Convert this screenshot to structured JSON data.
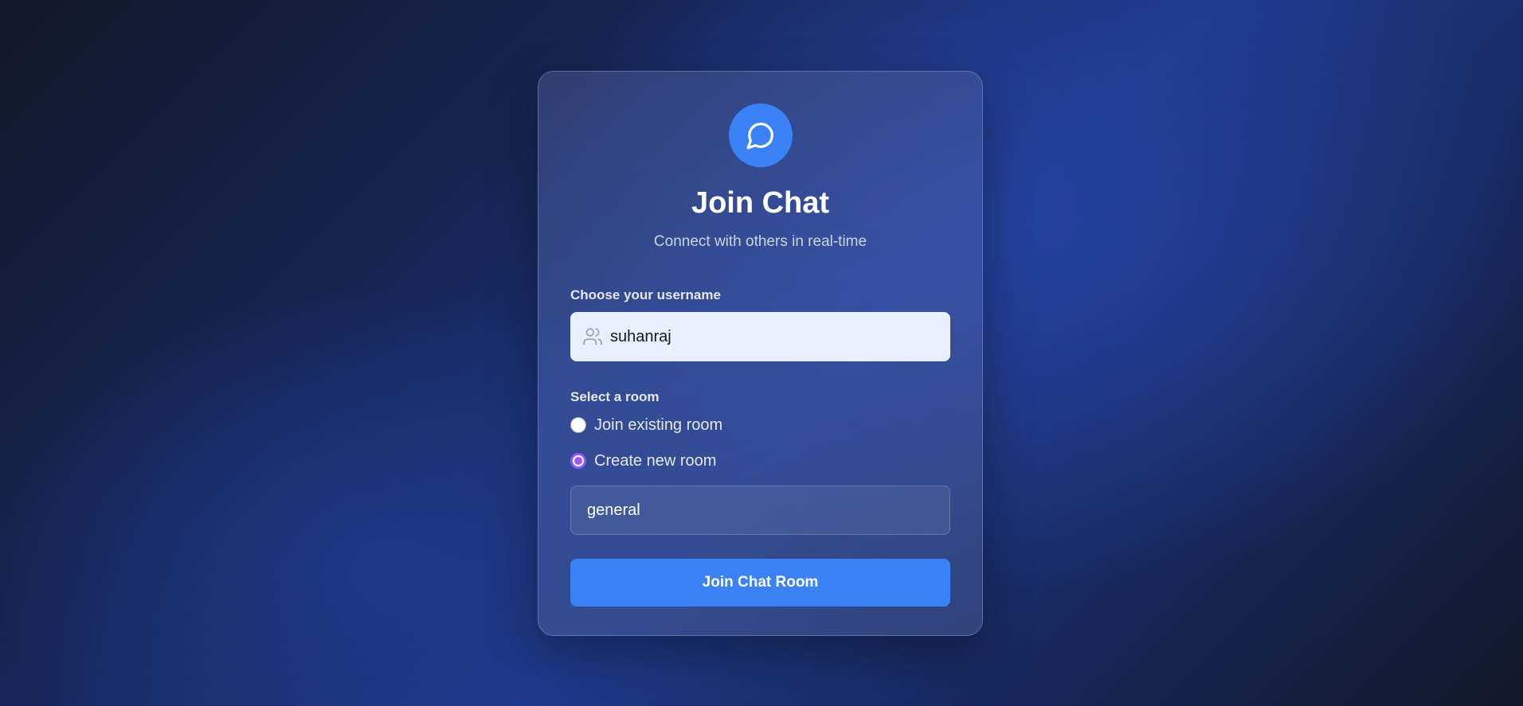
{
  "colors": {
    "accent": "#3b82f6",
    "radio_selected": "#a855f7",
    "input_background": "#e8effd"
  },
  "header": {
    "icon": "chat-bubble-icon",
    "title": "Join Chat",
    "subtitle": "Connect with others in real-time"
  },
  "username": {
    "label": "Choose your username",
    "icon": "users-icon",
    "value": "suhanraj"
  },
  "room": {
    "label": "Select a room",
    "options": [
      {
        "label": "Join existing room",
        "selected": false
      },
      {
        "label": "Create new room",
        "selected": true
      }
    ],
    "name_value": "general"
  },
  "actions": {
    "join_label": "Join Chat Room"
  }
}
